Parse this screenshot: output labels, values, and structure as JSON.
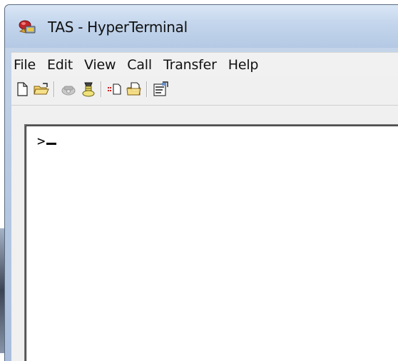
{
  "window": {
    "title": "TAS - HyperTerminal"
  },
  "menubar": {
    "items": [
      "File",
      "Edit",
      "View",
      "Call",
      "Transfer",
      "Help"
    ]
  },
  "toolbar": {
    "buttons": [
      {
        "name": "new-connection-icon"
      },
      {
        "name": "open-folder-icon"
      },
      {
        "name": "connect-phone-icon"
      },
      {
        "name": "disconnect-phone-icon"
      },
      {
        "name": "send-file-icon"
      },
      {
        "name": "receive-file-icon"
      },
      {
        "name": "properties-icon"
      }
    ]
  },
  "terminal": {
    "prompt": ">"
  },
  "colors": {
    "titlebar": "#c3d5ec",
    "menubar": "#f1f1f1",
    "terminal_bg": "#ffffff"
  }
}
